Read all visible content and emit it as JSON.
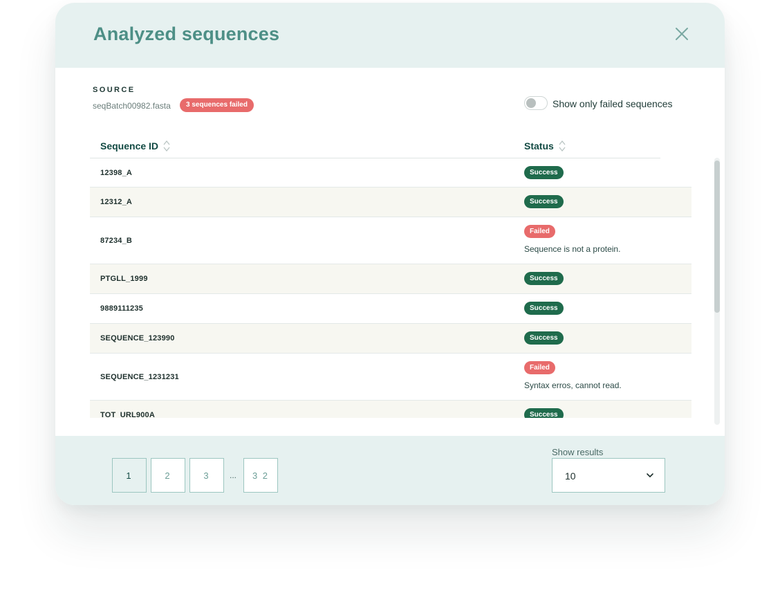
{
  "header": {
    "title": "Analyzed sequences",
    "close_icon": "close-icon"
  },
  "source": {
    "label": "SOURCE",
    "file_name": "seqBatch00982.fasta",
    "failed_badge": "3 sequences failed"
  },
  "filter": {
    "toggle_label": "Show only failed sequences",
    "toggle_on": false
  },
  "table": {
    "columns": [
      "Sequence ID",
      "Status"
    ],
    "rows": [
      {
        "id": "12398_A",
        "status": "Success",
        "message": ""
      },
      {
        "id": "12312_A",
        "status": "Success",
        "message": ""
      },
      {
        "id": "87234_B",
        "status": "Failed",
        "message": "Sequence is not a protein."
      },
      {
        "id": "PTGLL_1999",
        "status": "Success",
        "message": ""
      },
      {
        "id": "9889111235",
        "status": "Success",
        "message": ""
      },
      {
        "id": "SEQUENCE_123990",
        "status": "Success",
        "message": ""
      },
      {
        "id": "SEQUENCE_1231231",
        "status": "Failed",
        "message": "Syntax erros, cannot read."
      },
      {
        "id": "TOT_URL900A",
        "status": "Success",
        "message": ""
      }
    ]
  },
  "pagination": {
    "pages": [
      "1",
      "2",
      "3"
    ],
    "ellipsis": "...",
    "last_page": "3 2",
    "active_page": "1"
  },
  "results": {
    "label": "Show results",
    "selected": "10"
  },
  "colors": {
    "title": "#4d8f86",
    "header_bg": "#e6f1f0",
    "success": "#1f6b4c",
    "failed": "#e86b6b"
  }
}
